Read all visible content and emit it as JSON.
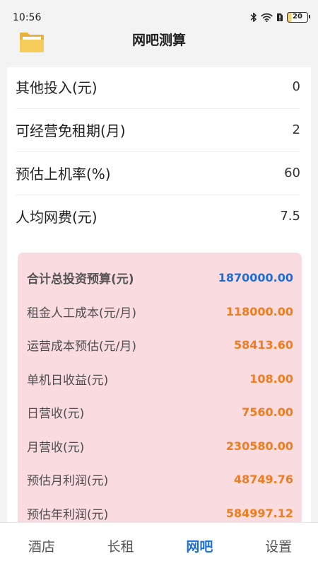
{
  "status_bar": {
    "time": "10:56",
    "battery_level": "20",
    "icons": [
      "bluetooth-icon",
      "wifi-icon",
      "sim-alert-icon",
      "battery-icon"
    ]
  },
  "header": {
    "title": "网吧测算",
    "icon": "folder-icon"
  },
  "inputs": [
    {
      "label": "其他投入(元)",
      "value": "0"
    },
    {
      "label": "可经营免租期(月)",
      "value": "2"
    },
    {
      "label": "预估上机率(%)",
      "value": "60"
    },
    {
      "label": "人均网费(元)",
      "value": "7.5"
    }
  ],
  "results": [
    {
      "label": "合计总投资预算(元)",
      "value": "1870000.00"
    },
    {
      "label": "租金人工成本(元/月)",
      "value": "118000.00"
    },
    {
      "label": "运营成本预估(元/月)",
      "value": "58413.60"
    },
    {
      "label": "单机日收益(元)",
      "value": "108.00"
    },
    {
      "label": "日营收(元)",
      "value": "7560.00"
    },
    {
      "label": "月营收(元)",
      "value": "230580.00"
    },
    {
      "label": "预估月利润(元)",
      "value": "48749.76"
    },
    {
      "label": "预估年利润(元)",
      "value": "584997.12"
    }
  ],
  "tabs": [
    {
      "label": "酒店",
      "active": false
    },
    {
      "label": "长租",
      "active": false
    },
    {
      "label": "网吧",
      "active": true
    },
    {
      "label": "设置",
      "active": false
    }
  ],
  "colors": {
    "accent": "#1d6fd8",
    "result_value": "#f07c1c",
    "result_card_bg": "#fadbe0",
    "page_bg": "#f3f3f3"
  }
}
